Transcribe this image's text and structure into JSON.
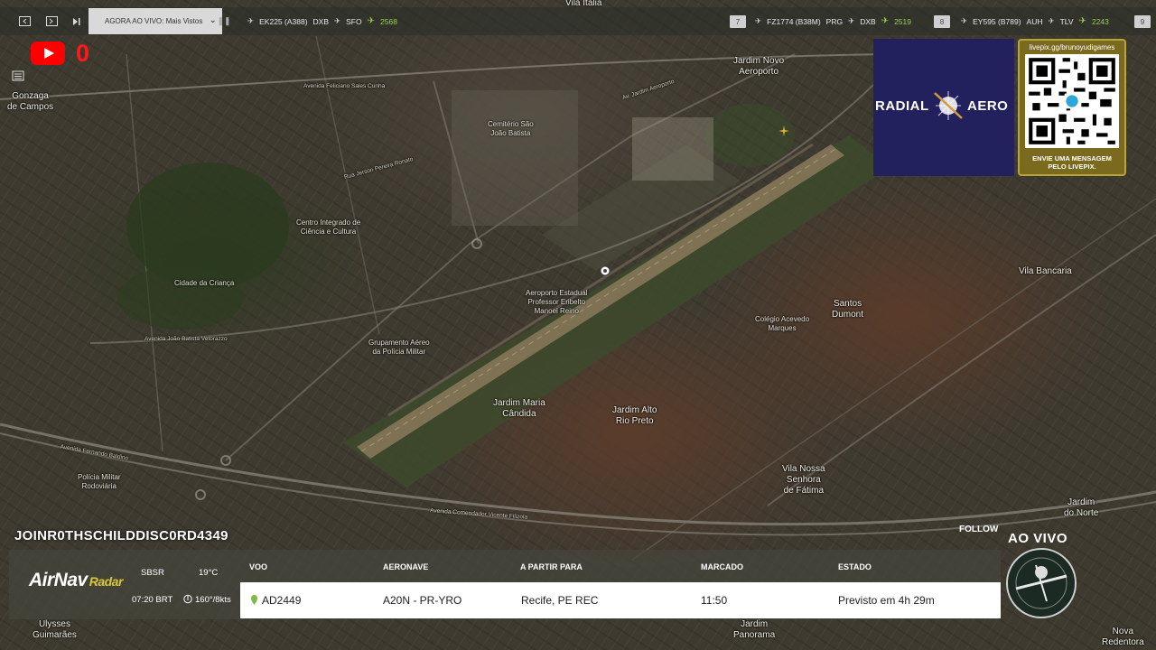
{
  "topbar": {
    "live_select": "AGORA AO VIVO: Mais Vistos",
    "flight1": {
      "code": "EK225 (A388)",
      "from": "DXB",
      "to": "SFO",
      "alt": "2568"
    },
    "flight2_rank": "7",
    "flight2": {
      "code": "FZ1774 (B38M)",
      "from": "PRG",
      "to": "DXB",
      "alt": "2519"
    },
    "flight3_rank": "8",
    "flight3": {
      "code": "EY595 (B789)",
      "from": "AUH",
      "to": "TLV",
      "alt": "2243"
    },
    "flight4_rank": "9",
    "arrow": "✈"
  },
  "youtube": {
    "count": "0"
  },
  "map_labels": {
    "vila_italia": "Vila Italia",
    "gonzaga": "Gonzaga\nde Campos",
    "jardim_novo": "Jardim Novo\nAeroporto",
    "cemiterio": "Cemitério São\nJoão Batista",
    "centro_integrado": "Centro Integrado de\nCiência e Cultura",
    "cidade_crianca": "Cidade da Criança",
    "aeroporto": "Aeroporto Estadual\nProfessor Eribelto\nManoel Reino",
    "grupamento": "Grupamento Aéreo\nda Polícia Militar",
    "jardim_maria": "Jardim Maria\nCândida",
    "jardim_alto": "Jardim Alto\nRio Preto",
    "santos_dumont": "Santos\nDumont",
    "vila_bancaria": "Vila Bancaria",
    "colegio": "Colégio Acevedo\nMarques",
    "vila_nossa": "Vila Nossa\nSenhora\nde Fátima",
    "jardim_norte": "Jardim\ndo Norte",
    "ulysses": "Ulysses\nGuimarães",
    "jardim_panorama": "Jardim\nPanorama",
    "nova_redentora": "Nova\nRedentora",
    "policia_rodoviaria": "Polícia Militar\nRodoviária",
    "av_feliciano": "Avenida Feliciano Sales Cunha",
    "av_fernando": "Avenida Fernando Baldino",
    "av_comendador": "Avenida Comendador Vicente Filizola",
    "av_joao_batista": "Avenida João Batista Vetorazzo",
    "av_jardim_aero": "Av. Jardim Aeroporto",
    "rua_jerson": "Rua Jerson Pereira Ronato"
  },
  "radial": {
    "left": "RADIAL",
    "right": "AERO"
  },
  "qr": {
    "url": "livepix.gg/brunoyudigames",
    "message": "ENVIE UMA MENSAGEM\nPELO LIVEPIX."
  },
  "bottom": {
    "channel": "JOINR0THSCHILDDISC0RD4349",
    "follow": "FOLLOW",
    "airnav": "AirNav",
    "radar": "Radar",
    "airport": "SBSR",
    "temp": "19°C",
    "time": "07:20 BRT",
    "wind": "160°/8kts",
    "headers": {
      "voo": "VOO",
      "aeronave": "AERONAVE",
      "partir": "A PARTIR PARA",
      "marcado": "MARCADO",
      "estado": "ESTADO"
    },
    "row": {
      "voo": "AD2449",
      "aeronave": "A20N - PR-YRO",
      "partir": "Recife, PE REC",
      "marcado": "11:50",
      "estado": "Previsto em 4h 29m"
    }
  },
  "ao_vivo": "AO VIVO",
  "colors": {
    "accent_green": "#9ad14b",
    "youtube_red": "#ff0000",
    "radial_bg": "#23205e",
    "qr_gold": "#7a6a1d"
  }
}
